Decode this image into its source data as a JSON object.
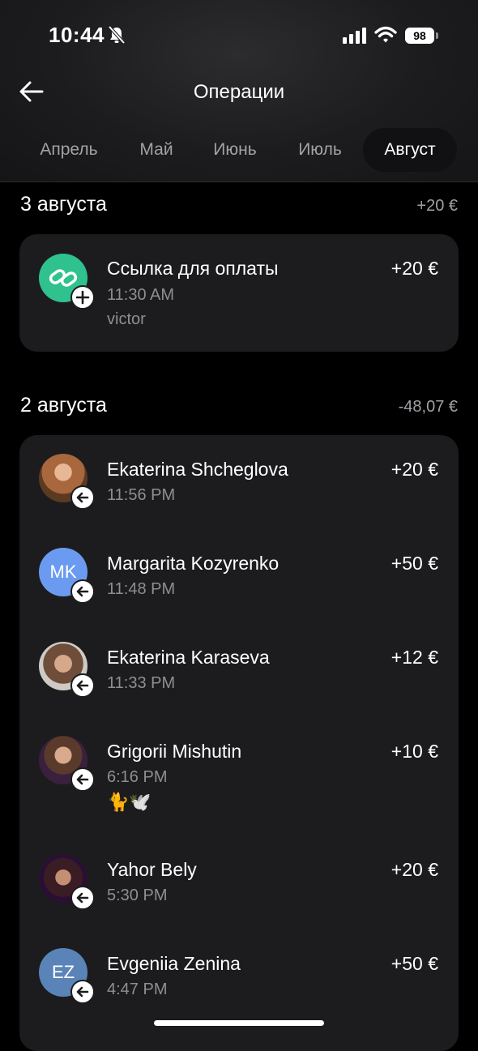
{
  "status_bar": {
    "time": "10:44",
    "battery": "98"
  },
  "header": {
    "title": "Операции"
  },
  "tabs": [
    {
      "label": "Апрель",
      "active": false
    },
    {
      "label": "Май",
      "active": false
    },
    {
      "label": "Июнь",
      "active": false
    },
    {
      "label": "Июль",
      "active": false
    },
    {
      "label": "Август",
      "active": true
    }
  ],
  "days": [
    {
      "date": "3 августа",
      "total": "+20 €",
      "transactions": [
        {
          "name": "Ссылка для оплаты",
          "time": "11:30 AM",
          "note": "victor",
          "amount": "+20 €",
          "avatar": "payment-link-icon",
          "badge": "plus-icon"
        }
      ]
    },
    {
      "date": "2 августа",
      "total": "-48,07 €",
      "transactions": [
        {
          "name": "Ekaterina Shcheglova",
          "time": "11:56 PM",
          "amount": "+20 €",
          "avatar": "photo",
          "badge": "incoming-arrow-icon"
        },
        {
          "name": "Margarita Kozyrenko",
          "time": "11:48 PM",
          "amount": "+50 €",
          "avatar_initials": "MK",
          "avatar_color": "#6b9bf0",
          "badge": "incoming-arrow-icon"
        },
        {
          "name": "Ekaterina Karaseva",
          "time": "11:33 PM",
          "amount": "+12 €",
          "avatar": "photo",
          "badge": "incoming-arrow-icon"
        },
        {
          "name": "Grigorii Mishutin",
          "time": "6:16 PM",
          "note": "🐈🕊️",
          "amount": "+10 €",
          "avatar": "photo",
          "badge": "incoming-arrow-icon"
        },
        {
          "name": "Yahor Bely",
          "time": "5:30 PM",
          "amount": "+20 €",
          "avatar": "photo",
          "badge": "incoming-arrow-icon"
        },
        {
          "name": "Evgeniia Zenina",
          "time": "4:47 PM",
          "amount": "+50 €",
          "avatar_initials": "EZ",
          "avatar_color": "#5a84b8",
          "badge": "incoming-arrow-icon"
        }
      ]
    }
  ],
  "colors": {
    "background": "#000000",
    "card": "#1c1c1e",
    "secondary_text": "#8e8e93",
    "payment_link": "#2fc28f"
  }
}
